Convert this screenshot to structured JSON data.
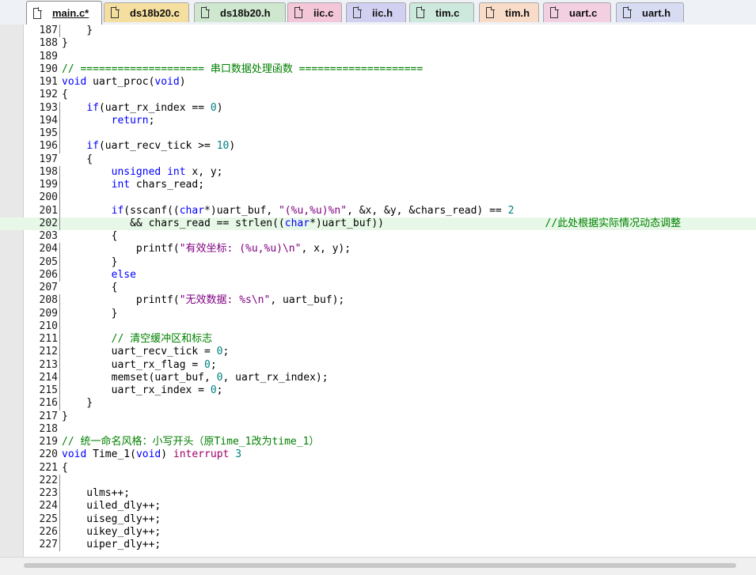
{
  "tabs": [
    {
      "label": "main.c*",
      "active": true,
      "color": "#ffffff"
    },
    {
      "label": "ds18b20.c",
      "active": false,
      "color": "#f5dfa0"
    },
    {
      "label": "ds18b20.h",
      "active": false,
      "color": "#cfe6cf"
    },
    {
      "label": "iic.c",
      "active": false,
      "color": "#f3c6d8"
    },
    {
      "label": "iic.h",
      "active": false,
      "color": "#d2d0f0"
    },
    {
      "label": "tim.c",
      "active": false,
      "color": "#cde8dc"
    },
    {
      "label": "tim.h",
      "active": false,
      "color": "#f8dcc8"
    },
    {
      "label": "uart.c",
      "active": false,
      "color": "#f3cfe2"
    },
    {
      "label": "uart.h",
      "active": false,
      "color": "#d8dcf3"
    }
  ],
  "highlighted_line": "202",
  "lines": [
    {
      "n": "187",
      "fold": true,
      "segs": [
        [
          "",
          "    }"
        ]
      ]
    },
    {
      "n": "188",
      "fold": false,
      "segs": [
        [
          "",
          "}"
        ]
      ]
    },
    {
      "n": "189",
      "fold": false,
      "segs": []
    },
    {
      "n": "190",
      "fold": false,
      "segs": [
        [
          "cm",
          "// ==================== 串口数据处理函数 ===================="
        ]
      ]
    },
    {
      "n": "191",
      "fold": false,
      "segs": [
        [
          "kw",
          "void"
        ],
        [
          "",
          " uart_proc("
        ],
        [
          "kw",
          "void"
        ],
        [
          "",
          ")"
        ]
      ]
    },
    {
      "n": "192",
      "fold": false,
      "segs": [
        [
          "",
          "{"
        ]
      ]
    },
    {
      "n": "193",
      "fold": true,
      "segs": [
        [
          "",
          "    "
        ],
        [
          "kw",
          "if"
        ],
        [
          "",
          "(uart_rx_index == "
        ],
        [
          "num",
          "0"
        ],
        [
          "",
          ")"
        ]
      ]
    },
    {
      "n": "194",
      "fold": true,
      "segs": [
        [
          "",
          "        "
        ],
        [
          "kw",
          "return"
        ],
        [
          "",
          ";"
        ]
      ]
    },
    {
      "n": "195",
      "fold": true,
      "segs": []
    },
    {
      "n": "196",
      "fold": true,
      "segs": [
        [
          "",
          "    "
        ],
        [
          "kw",
          "if"
        ],
        [
          "",
          "(uart_recv_tick >= "
        ],
        [
          "num",
          "10"
        ],
        [
          "",
          ")"
        ]
      ]
    },
    {
      "n": "197",
      "fold": false,
      "segs": [
        [
          "",
          "    {"
        ]
      ]
    },
    {
      "n": "198",
      "fold": true,
      "segs": [
        [
          "",
          "        "
        ],
        [
          "kw",
          "unsigned int"
        ],
        [
          "",
          " x, y;"
        ]
      ]
    },
    {
      "n": "199",
      "fold": true,
      "segs": [
        [
          "",
          "        "
        ],
        [
          "kw",
          "int"
        ],
        [
          "",
          " chars_read;"
        ]
      ]
    },
    {
      "n": "200",
      "fold": true,
      "segs": []
    },
    {
      "n": "201",
      "fold": true,
      "segs": [
        [
          "",
          "        "
        ],
        [
          "kw",
          "if"
        ],
        [
          "",
          "(sscanf(("
        ],
        [
          "kw",
          "char"
        ],
        [
          "",
          "*)uart_buf, "
        ],
        [
          "str",
          "\"(%u,%u)%n\""
        ],
        [
          "",
          ", &x, &y, &chars_read) == "
        ],
        [
          "num",
          "2"
        ]
      ]
    },
    {
      "n": "202",
      "fold": true,
      "segs": [
        [
          "",
          "           && chars_read == strlen(("
        ],
        [
          "kw",
          "char"
        ],
        [
          "",
          "*)uart_buf))                          "
        ],
        [
          "cm",
          "//此处根据实际情况动态调整"
        ]
      ]
    },
    {
      "n": "203",
      "fold": false,
      "segs": [
        [
          "",
          "        {"
        ]
      ]
    },
    {
      "n": "204",
      "fold": true,
      "segs": [
        [
          "",
          "            printf("
        ],
        [
          "str",
          "\"有效坐标: (%u,%u)\\n\""
        ],
        [
          "",
          ", x, y);"
        ]
      ]
    },
    {
      "n": "205",
      "fold": true,
      "segs": [
        [
          "",
          "        }"
        ]
      ]
    },
    {
      "n": "206",
      "fold": true,
      "segs": [
        [
          "",
          "        "
        ],
        [
          "kw",
          "else"
        ]
      ]
    },
    {
      "n": "207",
      "fold": false,
      "segs": [
        [
          "",
          "        {"
        ]
      ]
    },
    {
      "n": "208",
      "fold": true,
      "segs": [
        [
          "",
          "            printf("
        ],
        [
          "str",
          "\"无效数据: %s\\n\""
        ],
        [
          "",
          ", uart_buf);"
        ]
      ]
    },
    {
      "n": "209",
      "fold": true,
      "segs": [
        [
          "",
          "        }"
        ]
      ]
    },
    {
      "n": "210",
      "fold": true,
      "segs": []
    },
    {
      "n": "211",
      "fold": true,
      "segs": [
        [
          "",
          "        "
        ],
        [
          "cm",
          "// 清空缓冲区和标志"
        ]
      ]
    },
    {
      "n": "212",
      "fold": true,
      "segs": [
        [
          "",
          "        uart_recv_tick = "
        ],
        [
          "num",
          "0"
        ],
        [
          "",
          ";"
        ]
      ]
    },
    {
      "n": "213",
      "fold": true,
      "segs": [
        [
          "",
          "        uart_rx_flag = "
        ],
        [
          "num",
          "0"
        ],
        [
          "",
          ";"
        ]
      ]
    },
    {
      "n": "214",
      "fold": true,
      "segs": [
        [
          "",
          "        memset(uart_buf, "
        ],
        [
          "num",
          "0"
        ],
        [
          "",
          ", uart_rx_index);"
        ]
      ]
    },
    {
      "n": "215",
      "fold": true,
      "segs": [
        [
          "",
          "        uart_rx_index = "
        ],
        [
          "num",
          "0"
        ],
        [
          "",
          ";"
        ]
      ]
    },
    {
      "n": "216",
      "fold": true,
      "segs": [
        [
          "",
          "    }"
        ]
      ]
    },
    {
      "n": "217",
      "fold": false,
      "segs": [
        [
          "",
          "}"
        ]
      ]
    },
    {
      "n": "218",
      "fold": false,
      "segs": []
    },
    {
      "n": "219",
      "fold": false,
      "segs": [
        [
          "cm",
          "// 统一命名风格：小写开头（原Time_1改为time_1）"
        ]
      ]
    },
    {
      "n": "220",
      "fold": false,
      "segs": [
        [
          "kw",
          "void"
        ],
        [
          "",
          " Time_1("
        ],
        [
          "kw",
          "void"
        ],
        [
          "",
          ") "
        ],
        [
          "intr",
          "interrupt"
        ],
        [
          "",
          " "
        ],
        [
          "num",
          "3"
        ]
      ]
    },
    {
      "n": "221",
      "fold": false,
      "segs": [
        [
          "",
          "{"
        ]
      ]
    },
    {
      "n": "222",
      "fold": true,
      "segs": []
    },
    {
      "n": "223",
      "fold": true,
      "segs": [
        [
          "",
          "    ulms++;"
        ]
      ]
    },
    {
      "n": "224",
      "fold": true,
      "segs": [
        [
          "",
          "    uiled_dly++;"
        ]
      ]
    },
    {
      "n": "225",
      "fold": true,
      "segs": [
        [
          "",
          "    uiseg_dly++;"
        ]
      ]
    },
    {
      "n": "226",
      "fold": true,
      "segs": [
        [
          "",
          "    uikey_dly++;"
        ]
      ]
    },
    {
      "n": "227",
      "fold": true,
      "segs": [
        [
          "",
          "    uiper_dly++;"
        ]
      ]
    }
  ]
}
